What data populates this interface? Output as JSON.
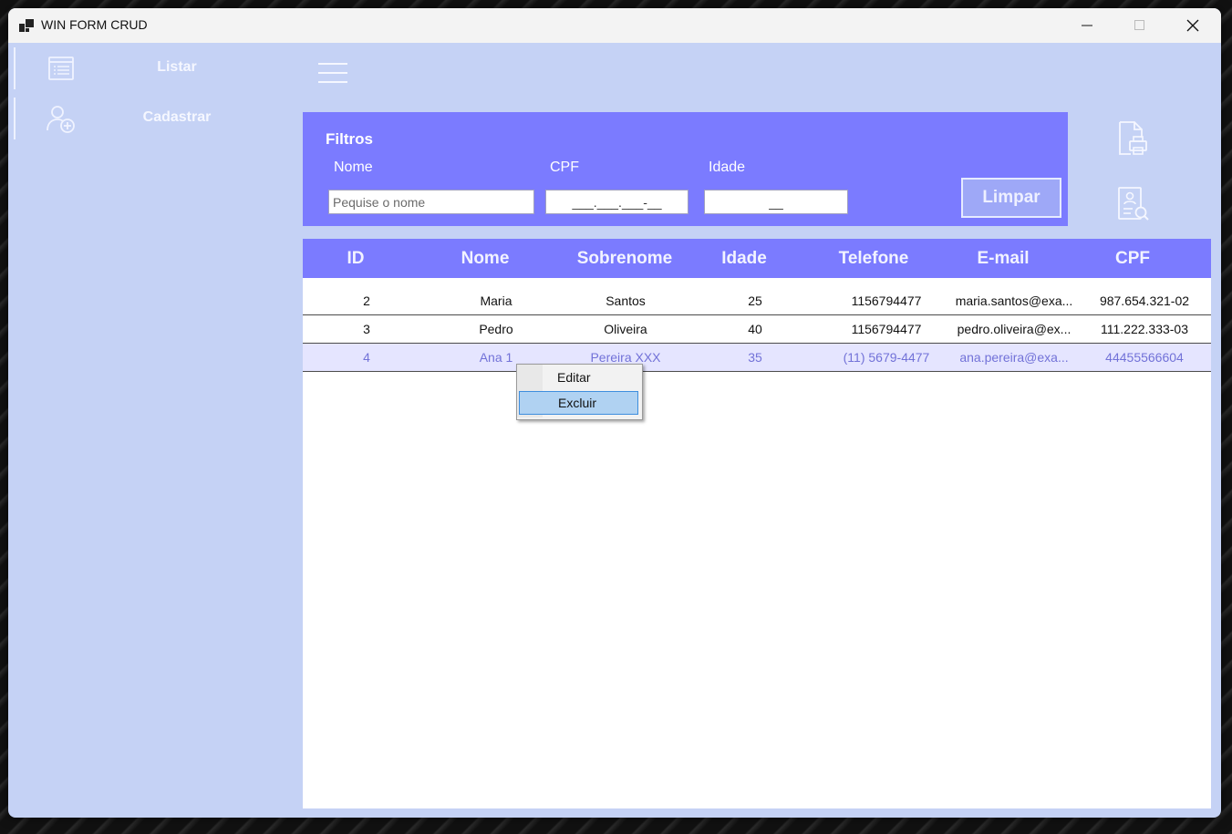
{
  "window": {
    "title": "WIN FORM CRUD"
  },
  "sidebar": {
    "items": [
      {
        "label": "Listar",
        "icon": "list-icon"
      },
      {
        "label": "Cadastrar",
        "icon": "add-user-icon"
      }
    ]
  },
  "filters": {
    "title": "Filtros",
    "nome_label": "Nome",
    "cpf_label": "CPF",
    "idade_label": "Idade",
    "nome_placeholder": "Pequise o nome",
    "cpf_mask": "___.___.___-__",
    "idade_mask": "__",
    "clear_label": "Limpar"
  },
  "table": {
    "columns": [
      "ID",
      "Nome",
      "Sobrenome",
      "Idade",
      "Telefone",
      "E-mail",
      "CPF"
    ],
    "rows": [
      [
        "2",
        "Maria",
        "Santos",
        "25",
        "1156794477",
        "maria.santos@exa...",
        "987.654.321-02"
      ],
      [
        "3",
        "Pedro",
        "Oliveira",
        "40",
        "1156794477",
        "pedro.oliveira@ex...",
        "111.222.333-03"
      ],
      [
        "4",
        "Ana 1",
        "Pereira XXX",
        "35",
        "(11) 5679-4477",
        "ana.pereira@exa...",
        "44455566604"
      ]
    ]
  },
  "context_menu": {
    "edit": "Editar",
    "delete": "Excluir"
  },
  "colors": {
    "panel": "#7b7bff",
    "window_bg": "#c5d2f5",
    "selected_row": "#e5e5ff",
    "menu_highlight": "#b0d2f2"
  }
}
